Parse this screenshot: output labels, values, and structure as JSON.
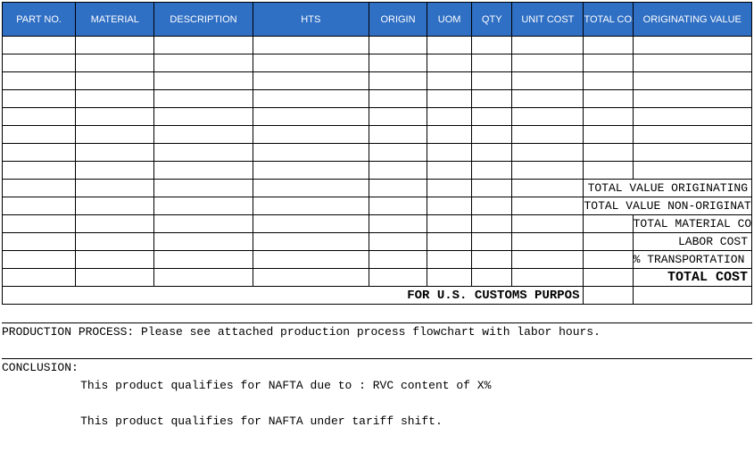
{
  "headers": {
    "part_no": "PART NO.",
    "material": "MATERIAL",
    "description": "DESCRIPTION",
    "hts": "HTS",
    "origin": "ORIGIN",
    "uom": "UOM",
    "qty": "QTY",
    "unit_cost": "UNIT COST",
    "total_cost": "TOTAL COST",
    "originating_value": "ORIGINATING VALUE"
  },
  "summary": {
    "total_value_originating": "TOTAL VALUE ORIGINATING",
    "total_value_non_originating": "TOTAL VALUE NON-ORIGINATING",
    "total_material_cost": "TOTAL MATERIAL COST",
    "labor_cost": "LABOR COST",
    "transportation_cost": "% TRANSPORTATION COST",
    "total_cost": "TOTAL COST"
  },
  "customs_line": "FOR U.S. CUSTOMS PURPOS",
  "production_process": "PRODUCTION PROCESS: Please see attached production process flowchart with labor hours.",
  "conclusion_label": "CONCLUSION:",
  "conclusion_line1": "This product qualifies for NAFTA due to :  RVC content of X%",
  "conclusion_line2": "This product qualifies for NAFTA under tariff shift."
}
